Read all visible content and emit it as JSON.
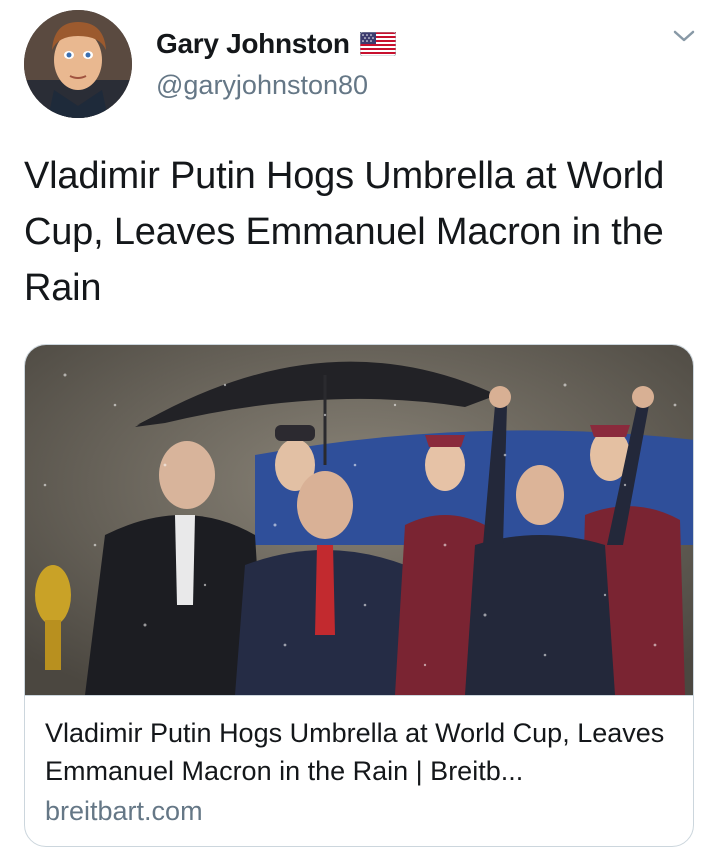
{
  "author": {
    "display_name": "Gary Johnston",
    "handle": "@garyjohnston80",
    "flag_icon": "us-flag-icon"
  },
  "tweet": {
    "text": "Vladimir Putin Hogs Umbrella at World Cup, Leaves Emmanuel Macron in the Rain"
  },
  "link_card": {
    "title": "Vladimir Putin Hogs Umbrella at World Cup, Leaves Emmanuel Macron in the Rain | Breitb...",
    "domain": "breitbart.com"
  },
  "colors": {
    "primary_text": "#14171a",
    "secondary_text": "#657786",
    "border": "#ccd6dd"
  }
}
